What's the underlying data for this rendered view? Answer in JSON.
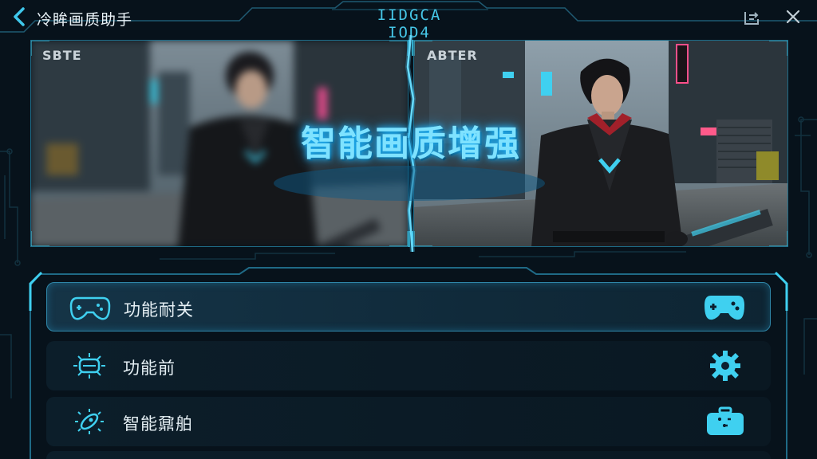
{
  "header": {
    "app_title": "冷眸画质助手",
    "center_title": "IIDGCA IOD4"
  },
  "comparison": {
    "before_label": "SBTE",
    "after_label": "ABTER",
    "headline": "智能画质增强"
  },
  "menu": {
    "items": [
      {
        "label": "功能耐关",
        "active": true
      },
      {
        "label": "功能前",
        "active": false
      },
      {
        "label": "智能鼐舶",
        "active": false
      }
    ]
  },
  "colors": {
    "accent": "#3fd0f0",
    "background": "#07121b",
    "headline": "#7ee2ff"
  }
}
